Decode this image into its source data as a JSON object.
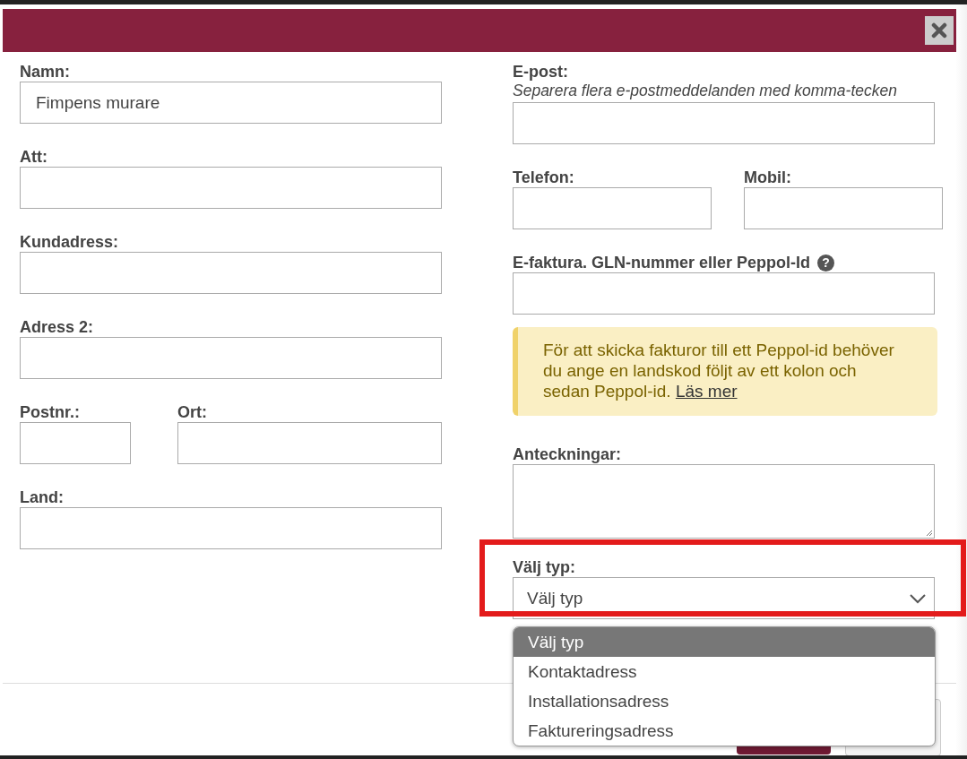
{
  "left_rows": [
    {
      "kind": "single",
      "fields": [
        {
          "label": "Namn:",
          "value": "Fimpens murare"
        }
      ]
    },
    {
      "kind": "single",
      "fields": [
        {
          "label": "Att:"
        }
      ]
    },
    {
      "kind": "single",
      "fields": [
        {
          "label": "Kundadress:"
        }
      ]
    },
    {
      "kind": "single",
      "fields": [
        {
          "label": "Adress 2:"
        }
      ]
    },
    {
      "kind": "postal",
      "fields": [
        {
          "label": "Postnr.:"
        },
        {
          "label": "Ort:"
        }
      ]
    },
    {
      "kind": "single",
      "fields": [
        {
          "label": "Land:"
        }
      ]
    }
  ],
  "email": {
    "label": "E-post:",
    "hint": "Separera flera e-postmeddelanden med komma-tecken"
  },
  "phone_row": {
    "kind": "phone",
    "fields": [
      {
        "label": "Telefon:"
      },
      {
        "label": "Mobil:"
      }
    ]
  },
  "einvoice": {
    "label": "E-faktura. GLN-nummer eller Peppol-Id",
    "help": "?"
  },
  "notice": {
    "text": "För att skicka fakturor till ett Peppol-id behöver du ange en landskod följt av ett kolon och sedan Peppol-id.",
    "link": "Läs mer"
  },
  "notes": {
    "label": "Anteckningar:"
  },
  "type_select": {
    "label": "Välj typ:",
    "value": "Välj typ",
    "expanded": true,
    "highlighted": true,
    "options": [
      {
        "label": "Välj typ",
        "selected": true
      },
      {
        "label": "Kontaktadress",
        "selected": false
      },
      {
        "label": "Installationsadress",
        "selected": false
      },
      {
        "label": "Faktureringsadress",
        "selected": false
      }
    ]
  }
}
